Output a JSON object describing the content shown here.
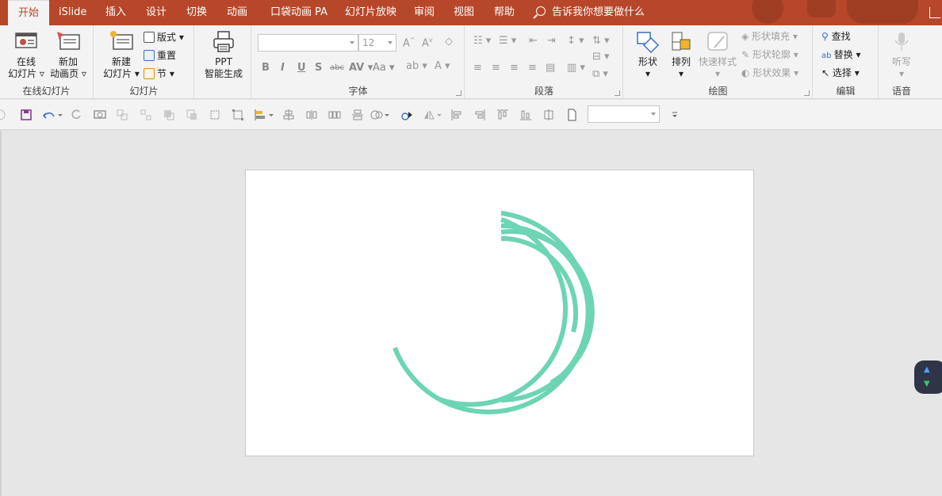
{
  "tabs": [
    {
      "label": "开始",
      "active": true
    },
    {
      "label": "iSlide"
    },
    {
      "label": "插入"
    },
    {
      "label": "设计"
    },
    {
      "label": "切换"
    },
    {
      "label": "动画"
    },
    {
      "label": "口袋动画 PA"
    },
    {
      "label": "幻灯片放映"
    },
    {
      "label": "审阅"
    },
    {
      "label": "视图"
    },
    {
      "label": "帮助"
    }
  ],
  "tell_me": "告诉我你想要做什么",
  "ribbon": {
    "online": {
      "btn1_line1": "在线",
      "btn1_line2": "幻灯片",
      "btn2_line1": "新加",
      "btn2_line2": "动画页",
      "label": "在线幻灯片"
    },
    "slides": {
      "new_line1": "新建",
      "new_line2": "幻灯片",
      "layout": "版式",
      "reset": "重置",
      "section": "节",
      "label": "幻灯片"
    },
    "ppt": {
      "line1": "PPT",
      "line2": "智能生成"
    },
    "font": {
      "size": "12",
      "label": "字体"
    },
    "paragraph": {
      "label": "段落"
    },
    "drawing": {
      "shapes": "形状",
      "arrange": "排列",
      "quick_styles": "快速样式",
      "fill": "形状填充",
      "outline": "形状轮廓",
      "effects": "形状效果",
      "label": "绘图"
    },
    "editing": {
      "find": "查找",
      "replace": "替换",
      "select": "选择",
      "label": "编辑"
    },
    "voice": {
      "dictate": "听写",
      "label": "语音"
    }
  },
  "colors": {
    "accent": "#b7472a",
    "arc": "#6dd4b4",
    "qat_icon": "#8f8f8f",
    "save_icon": "#8b3b8e",
    "undo_icon": "#3a6fc4"
  },
  "slide_graphic": {
    "type": "concentric partial arcs",
    "arc_count": 5
  }
}
